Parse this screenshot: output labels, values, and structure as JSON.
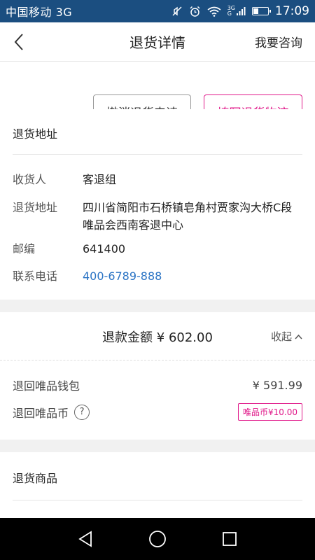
{
  "statusbar": {
    "carrier": "中国移动 3G",
    "time": "17:09",
    "icons": [
      "mute-icon",
      "alarm-icon",
      "wifi-icon",
      "signal-icon",
      "battery-icon"
    ],
    "net_top": "3G",
    "net_bottom": "G"
  },
  "header": {
    "title": "退货详情",
    "consult": "我要咨询"
  },
  "actions": {
    "cancel_label": "撤消退货申请",
    "fill_label": "填写退货物流"
  },
  "address": {
    "title": "退货地址",
    "receiver_label": "收货人",
    "receiver_value": "客退组",
    "address_label": "退货地址",
    "address_value": "四川省简阳市石桥镇皂角村贾家沟大桥C段唯品会西南客退中心",
    "zip_label": "邮编",
    "zip_value": "641400",
    "phone_label": "联系电话",
    "phone_value": "400-6789-888"
  },
  "refund": {
    "total": "退款金额 ¥ 602.00",
    "collapse_label": "收起",
    "wallet_label": "退回唯品钱包",
    "wallet_amount": "¥ 591.99",
    "coin_label": "退回唯品币",
    "coin_help": "?",
    "coin_badge": "唯品币¥10.00"
  },
  "goods": {
    "title": "退货商品"
  },
  "colors": {
    "statusbar": "#1b4e80",
    "accent": "#e0198a",
    "link": "#2a73c4"
  }
}
